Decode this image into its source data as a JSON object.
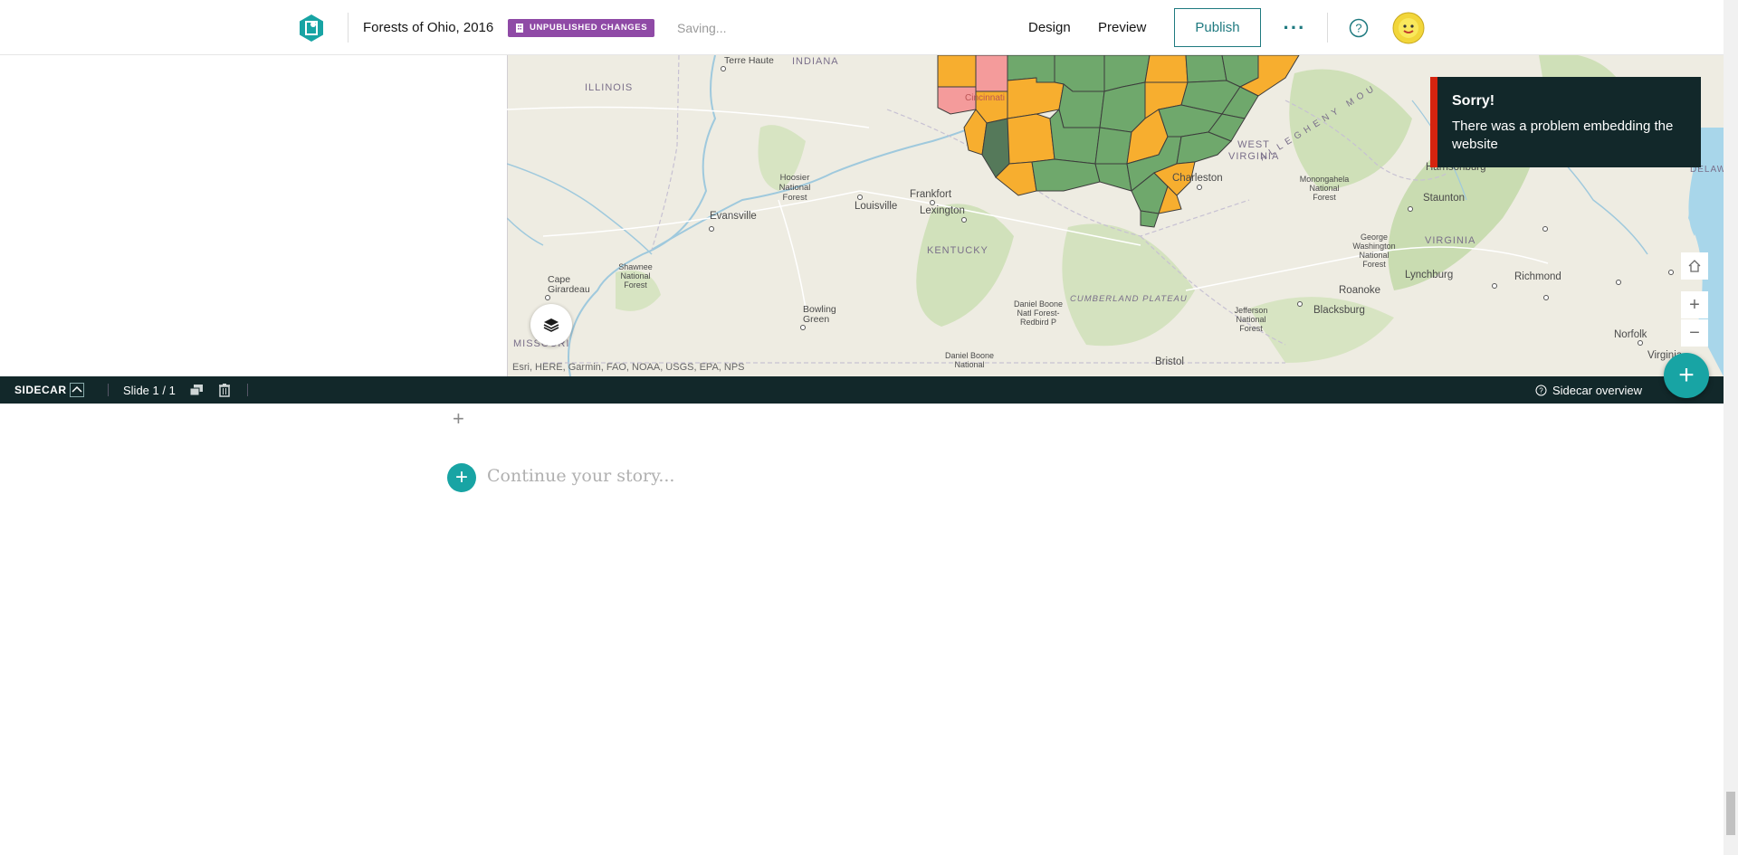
{
  "header": {
    "story_title": "Forests of Ohio, 2016",
    "badge_label": "UNPUBLISHED CHANGES",
    "status_text": "Saving...",
    "nav_design": "Design",
    "nav_preview": "Preview",
    "publish_label": "Publish",
    "more_icon": "ellipsis-icon",
    "help_icon": "help-icon",
    "avatar_icon": "avatar"
  },
  "map": {
    "labels": {
      "terre_haute": "Terre Haute",
      "indiana": "INDIANA",
      "illinois": "ILLINOIS",
      "hoosier": "Hoosier National Forest",
      "louisville": "Louisville",
      "frankfort": "Frankfort",
      "lexington": "Lexington",
      "evansville": "Evansville",
      "kentucky": "KENTUCKY",
      "shawnee": "Shawnee National Forest",
      "cape_girardeau": "Cape Girardeau",
      "missouri": "MISSOURI",
      "bowling_green": "Bowling Green",
      "daniel_boone": "Daniel Boone Natl Forest-Redbird P",
      "daniel_boone2": "Daniel Boone National",
      "cumberland": "CUMBERLAND PLATEAU",
      "charleston": "Charleston",
      "west_virginia": "WEST VIRGINIA",
      "allegheny": "ALLEGHENY MOU",
      "monongahela": "Monongahela National Forest",
      "harrisonburg": "Harrisonburg",
      "staunton": "Staunton",
      "virginia": "VIRGINIA",
      "george_washington": "George Washington National Forest",
      "lynchburg": "Lynchburg",
      "roanoke": "Roanoke",
      "richmond": "Richmond",
      "blacksburg": "Blacksburg",
      "jefferson": "Jefferson National Forest",
      "norfolk": "Norfolk",
      "virginia_beach": "Virginia",
      "bristol": "Bristol",
      "delaw": "DELAW",
      "cincinnati": "Cincinnati"
    },
    "attribution": "Esri, HERE, Garmin, FAO, NOAA, USGS, EPA, NPS",
    "controls": {
      "home_icon": "home-icon",
      "zoom_in_icon": "zoom-in-icon",
      "zoom_out_icon": "zoom-out-icon",
      "layers_icon": "layers-icon"
    },
    "colors": {
      "forest_green": "#6fa86c",
      "forest_dark": "#55795a",
      "forest_orange": "#f7ae2f",
      "forest_pink": "#f49b9b"
    }
  },
  "toast": {
    "title": "Sorry!",
    "message": "There was a problem embedding the website"
  },
  "sidecar": {
    "label": "SIDECAR",
    "slide_counter": "Slide 1 / 1",
    "overview_label": "Sidecar overview"
  },
  "editor": {
    "continue_placeholder": "Continue your story..."
  },
  "colors": {
    "accent": "#18a4a4",
    "dark_bar": "#12282a",
    "badge": "#8f4aa6",
    "error": "#d5240f"
  }
}
